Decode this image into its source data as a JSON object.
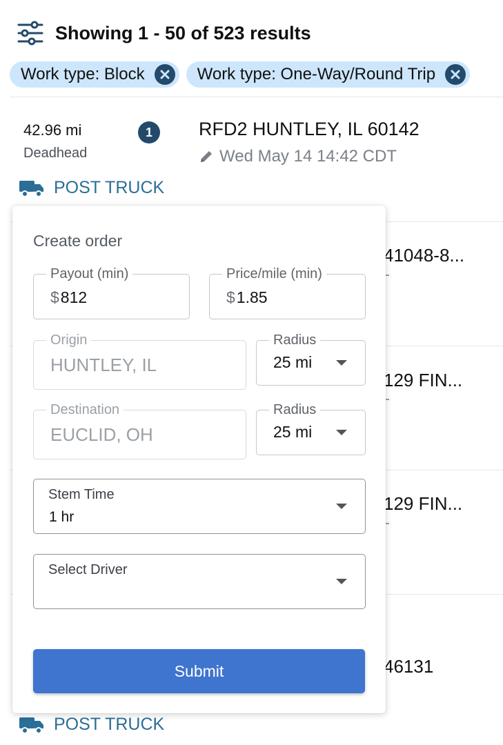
{
  "header": {
    "results_text": "Showing 1 - 50 of 523 results"
  },
  "filters": [
    {
      "label": "Work type: Block"
    },
    {
      "label": "Work type: One-Way/Round Trip"
    }
  ],
  "card1": {
    "distance": "42.96 mi",
    "distance_type": "Deadhead",
    "badge": "1",
    "route": "RFD2 HUNTLEY, IL 60142",
    "time": "Wed May 14 14:42 CDT",
    "post_truck_label": "POST TRUCK"
  },
  "background_cards": [
    {
      "text": "41048-8..."
    },
    {
      "text": "129 FIN..."
    },
    {
      "text": "129 FIN..."
    },
    {
      "text": "46131"
    }
  ],
  "bottom_post_truck_label": "POST TRUCK",
  "create_order": {
    "title": "Create order",
    "payout": {
      "label": "Payout (min)",
      "prefix": "$",
      "value": "812"
    },
    "price_per_mile": {
      "label": "Price/mile (min)",
      "prefix": "$",
      "value": "1.85"
    },
    "origin": {
      "label": "Origin",
      "value": "HUNTLEY, IL"
    },
    "origin_radius": {
      "label": "Radius",
      "value": "25 mi"
    },
    "destination": {
      "label": "Destination",
      "value": "EUCLID, OH"
    },
    "destination_radius": {
      "label": "Radius",
      "value": "25 mi"
    },
    "stem_time": {
      "label": "Stem Time",
      "value": "1 hr"
    },
    "driver": {
      "label": "Select Driver",
      "value": ""
    },
    "submit_label": "Submit"
  },
  "colors": {
    "accent": "#3f74cf",
    "chip_bg": "#cde6fb",
    "chip_close": "#234a6b",
    "link": "#2b6e97"
  },
  "icons": [
    "filter-sliders-icon",
    "close-circle-icon",
    "pencil-icon",
    "truck-icon",
    "chevron-down-icon"
  ]
}
